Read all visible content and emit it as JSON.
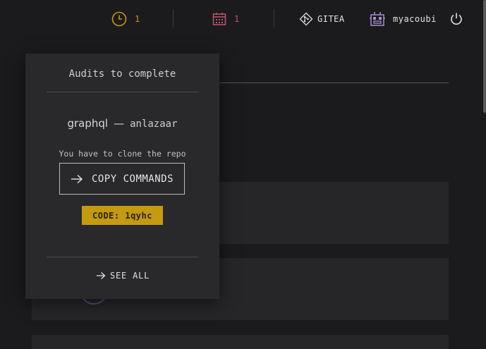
{
  "topbar": {
    "pending_count": "1",
    "events_count": "1",
    "gitea_label": "GITEA",
    "username": "myacoubi"
  },
  "popup": {
    "title": "Audits to complete",
    "project": "graphql",
    "separator": "—",
    "user": "anlazaar",
    "note": "You have to clone the repo",
    "copy_label": "COPY COMMANDS",
    "code": "CODE: 1qyhc",
    "see_all": "SEE ALL"
  },
  "colors": {
    "accent_yellow": "#c49a12",
    "accent_pink": "#c0576f",
    "accent_purple": "#a78fd4",
    "background": "#1b1a1c",
    "panel": "#29282b"
  },
  "icons": {
    "pending": "clock-icon",
    "events": "calendar-icon",
    "gitea": "git-icon",
    "user": "robot-avatar-icon",
    "logout": "power-icon",
    "copy": "arrow-right-icon",
    "see_all": "arrow-right-icon"
  }
}
